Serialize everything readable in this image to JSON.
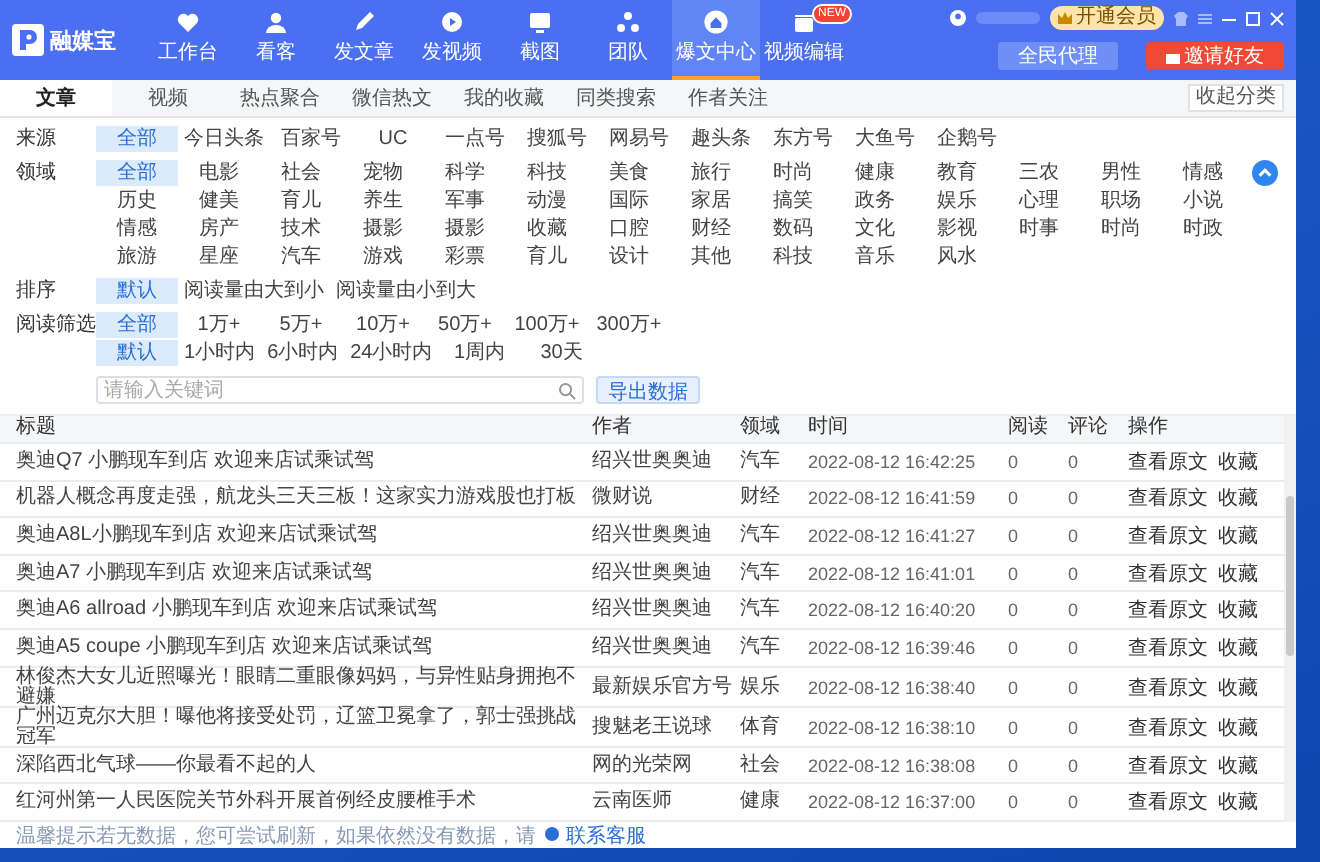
{
  "header": {
    "logo": "融媒宝",
    "nav": [
      {
        "label": "工作台",
        "selected": false
      },
      {
        "label": "看客",
        "selected": false
      },
      {
        "label": "发文章",
        "selected": false
      },
      {
        "label": "发视频",
        "selected": false
      },
      {
        "label": "截图",
        "selected": false
      },
      {
        "label": "团队",
        "selected": false
      },
      {
        "label": "爆文中心",
        "selected": true
      },
      {
        "label": "视频编辑",
        "selected": false,
        "badge": "NEW"
      }
    ],
    "vip_button": "开通会员",
    "buttons": [
      {
        "label": "全民代理",
        "kind": "secondary"
      },
      {
        "label": "邀请好友",
        "kind": "primary"
      }
    ]
  },
  "tabs": [
    {
      "label": "文章",
      "selected": true
    },
    {
      "label": "视频",
      "selected": false
    },
    {
      "label": "热点聚合",
      "selected": false
    },
    {
      "label": "微信热文",
      "selected": false
    },
    {
      "label": "我的收藏",
      "selected": false
    },
    {
      "label": "同类搜索",
      "selected": false
    },
    {
      "label": "作者关注",
      "selected": false
    }
  ],
  "collapse_link": "收起分类",
  "filters": [
    {
      "label": "来源",
      "rows": [
        [
          {
            "label": "全部",
            "selected": true
          },
          {
            "label": "今日头条",
            "selected": false
          },
          {
            "label": "百家号",
            "selected": false
          },
          {
            "label": "UC",
            "selected": false
          },
          {
            "label": "一点号",
            "selected": false
          },
          {
            "label": "搜狐号",
            "selected": false
          },
          {
            "label": "网易号",
            "selected": false
          },
          {
            "label": "趣头条",
            "selected": false
          },
          {
            "label": "东方号",
            "selected": false
          },
          {
            "label": "大鱼号",
            "selected": false
          },
          {
            "label": "企鹅号",
            "selected": false
          }
        ]
      ]
    },
    {
      "label": "领域",
      "expanded": true,
      "rows": [
        [
          {
            "label": "全部",
            "selected": true
          },
          {
            "label": "电影",
            "selected": false
          },
          {
            "label": "社会",
            "selected": false
          },
          {
            "label": "宠物",
            "selected": false
          },
          {
            "label": "科学",
            "selected": false
          },
          {
            "label": "科技",
            "selected": false
          },
          {
            "label": "美食",
            "selected": false
          },
          {
            "label": "旅行",
            "selected": false
          },
          {
            "label": "时尚",
            "selected": false
          },
          {
            "label": "健康",
            "selected": false
          },
          {
            "label": "教育",
            "selected": false
          },
          {
            "label": "三农",
            "selected": false
          },
          {
            "label": "男性",
            "selected": false
          },
          {
            "label": "情感",
            "selected": false
          },
          {
            "label": "历史",
            "selected": false
          },
          {
            "label": "健美",
            "selected": false
          },
          {
            "label": "育儿",
            "selected": false
          },
          {
            "label": "养生",
            "selected": false
          },
          {
            "label": "军事",
            "selected": false
          },
          {
            "label": "动漫",
            "selected": false
          },
          {
            "label": "国际",
            "selected": false
          },
          {
            "label": "家居",
            "selected": false
          },
          {
            "label": "搞笑",
            "selected": false
          },
          {
            "label": "政务",
            "selected": false
          },
          {
            "label": "娱乐",
            "selected": false
          },
          {
            "label": "心理",
            "selected": false
          },
          {
            "label": "职场",
            "selected": false
          },
          {
            "label": "小说",
            "selected": false
          },
          {
            "label": "情感",
            "selected": false
          },
          {
            "label": "房产",
            "selected": false
          },
          {
            "label": "技术",
            "selected": false
          },
          {
            "label": "摄影",
            "selected": false
          },
          {
            "label": "摄影",
            "selected": false
          },
          {
            "label": "收藏",
            "selected": false
          },
          {
            "label": "口腔",
            "selected": false
          },
          {
            "label": "财经",
            "selected": false
          },
          {
            "label": "数码",
            "selected": false
          },
          {
            "label": "文化",
            "selected": false
          },
          {
            "label": "影视",
            "selected": false
          },
          {
            "label": "时事",
            "selected": false
          },
          {
            "label": "时尚",
            "selected": false
          },
          {
            "label": "时政",
            "selected": false
          },
          {
            "label": "旅游",
            "selected": false
          },
          {
            "label": "星座",
            "selected": false
          },
          {
            "label": "汽车",
            "selected": false
          },
          {
            "label": "游戏",
            "selected": false
          },
          {
            "label": "彩票",
            "selected": false
          },
          {
            "label": "育儿",
            "selected": false
          },
          {
            "label": "设计",
            "selected": false
          },
          {
            "label": "其他",
            "selected": false
          },
          {
            "label": "科技",
            "selected": false
          },
          {
            "label": "音乐",
            "selected": false
          },
          {
            "label": "风水",
            "selected": false
          }
        ]
      ]
    },
    {
      "label": "排序",
      "rows": [
        [
          {
            "label": "默认",
            "selected": true
          },
          {
            "label": "阅读量由大到小",
            "selected": false
          },
          {
            "label": "阅读量由小到大",
            "selected": false
          }
        ]
      ]
    },
    {
      "label": "阅读筛选",
      "rows": [
        [
          {
            "label": "全部",
            "selected": true
          },
          {
            "label": "1万+",
            "selected": false
          },
          {
            "label": "5万+",
            "selected": false
          },
          {
            "label": "10万+",
            "selected": false
          },
          {
            "label": "50万+",
            "selected": false
          },
          {
            "label": "100万+",
            "selected": false
          },
          {
            "label": "300万+",
            "selected": false
          }
        ],
        [
          {
            "label": "默认",
            "selected": true
          },
          {
            "label": "1小时内",
            "selected": false
          },
          {
            "label": "6小时内",
            "selected": false
          },
          {
            "label": "24小时内",
            "selected": false
          },
          {
            "label": "1周内",
            "selected": false
          },
          {
            "label": "30天",
            "selected": false
          }
        ]
      ]
    }
  ],
  "search": {
    "placeholder": "请输入关键词"
  },
  "export_button": "导出数据",
  "table": {
    "columns": [
      "标题",
      "作者",
      "领域",
      "时间",
      "阅读",
      "评论",
      "操作"
    ],
    "rows": [
      {
        "title": "奥迪Q7 小鹏现车到店 欢迎来店试乘试驾",
        "author": "绍兴世奥奥迪",
        "field": "汽车",
        "time": "2022-08-12 16:42:25",
        "reads": "0",
        "comments": "0",
        "actions": [
          "查看原文",
          "收藏"
        ]
      },
      {
        "title": "机器人概念再度走强，航龙头三天三板！这家实力游戏股也打板",
        "author": "微财说",
        "field": "财经",
        "time": "2022-08-12 16:41:59",
        "reads": "0",
        "comments": "0",
        "actions": [
          "查看原文",
          "收藏"
        ]
      },
      {
        "title": "奥迪A8L小鹏现车到店 欢迎来店试乘试驾",
        "author": "绍兴世奥奥迪",
        "field": "汽车",
        "time": "2022-08-12 16:41:27",
        "reads": "0",
        "comments": "0",
        "actions": [
          "查看原文",
          "收藏"
        ]
      },
      {
        "title": "奥迪A7 小鹏现车到店 欢迎来店试乘试驾",
        "author": "绍兴世奥奥迪",
        "field": "汽车",
        "time": "2022-08-12 16:41:01",
        "reads": "0",
        "comments": "0",
        "actions": [
          "查看原文",
          "收藏"
        ]
      },
      {
        "title": "奥迪A6 allroad 小鹏现车到店 欢迎来店试乘试驾",
        "author": "绍兴世奥奥迪",
        "field": "汽车",
        "time": "2022-08-12 16:40:20",
        "reads": "0",
        "comments": "0",
        "actions": [
          "查看原文",
          "收藏"
        ]
      },
      {
        "title": "奥迪A5 coupe 小鹏现车到店 欢迎来店试乘试驾",
        "author": "绍兴世奥奥迪",
        "field": "汽车",
        "time": "2022-08-12 16:39:46",
        "reads": "0",
        "comments": "0",
        "actions": [
          "查看原文",
          "收藏"
        ]
      },
      {
        "title": "林俊杰大女儿近照曝光！眼睛二重眼像妈妈，与异性贴身拥抱不避嫌",
        "author": "最新娱乐官方号",
        "field": "娱乐",
        "time": "2022-08-12 16:38:40",
        "reads": "0",
        "comments": "0",
        "actions": [
          "查看原文",
          "收藏"
        ]
      },
      {
        "title": "广州迈克尔大胆！曝他将接受处罚，辽篮卫冕拿了，郭士强挑战冠军",
        "author": "搜魅老王说球",
        "field": "体育",
        "time": "2022-08-12 16:38:10",
        "reads": "0",
        "comments": "0",
        "actions": [
          "查看原文",
          "收藏"
        ]
      },
      {
        "title": "深陷西北气球——你最看不起的人",
        "author": "网的光荣网",
        "field": "社会",
        "time": "2022-08-12 16:38:08",
        "reads": "0",
        "comments": "0",
        "actions": [
          "查看原文",
          "收藏"
        ]
      },
      {
        "title": "红河州第一人民医院关节外科开展首例经皮腰椎手术",
        "author": "云南医师",
        "field": "健康",
        "time": "2022-08-12 16:37:00",
        "reads": "0",
        "comments": "0",
        "actions": [
          "查看原文",
          "收藏"
        ]
      }
    ]
  },
  "footer": {
    "text": "温馨提示若无数据，您可尝试刷新，如果依然没有数据，请",
    "link": "联系客服"
  }
}
